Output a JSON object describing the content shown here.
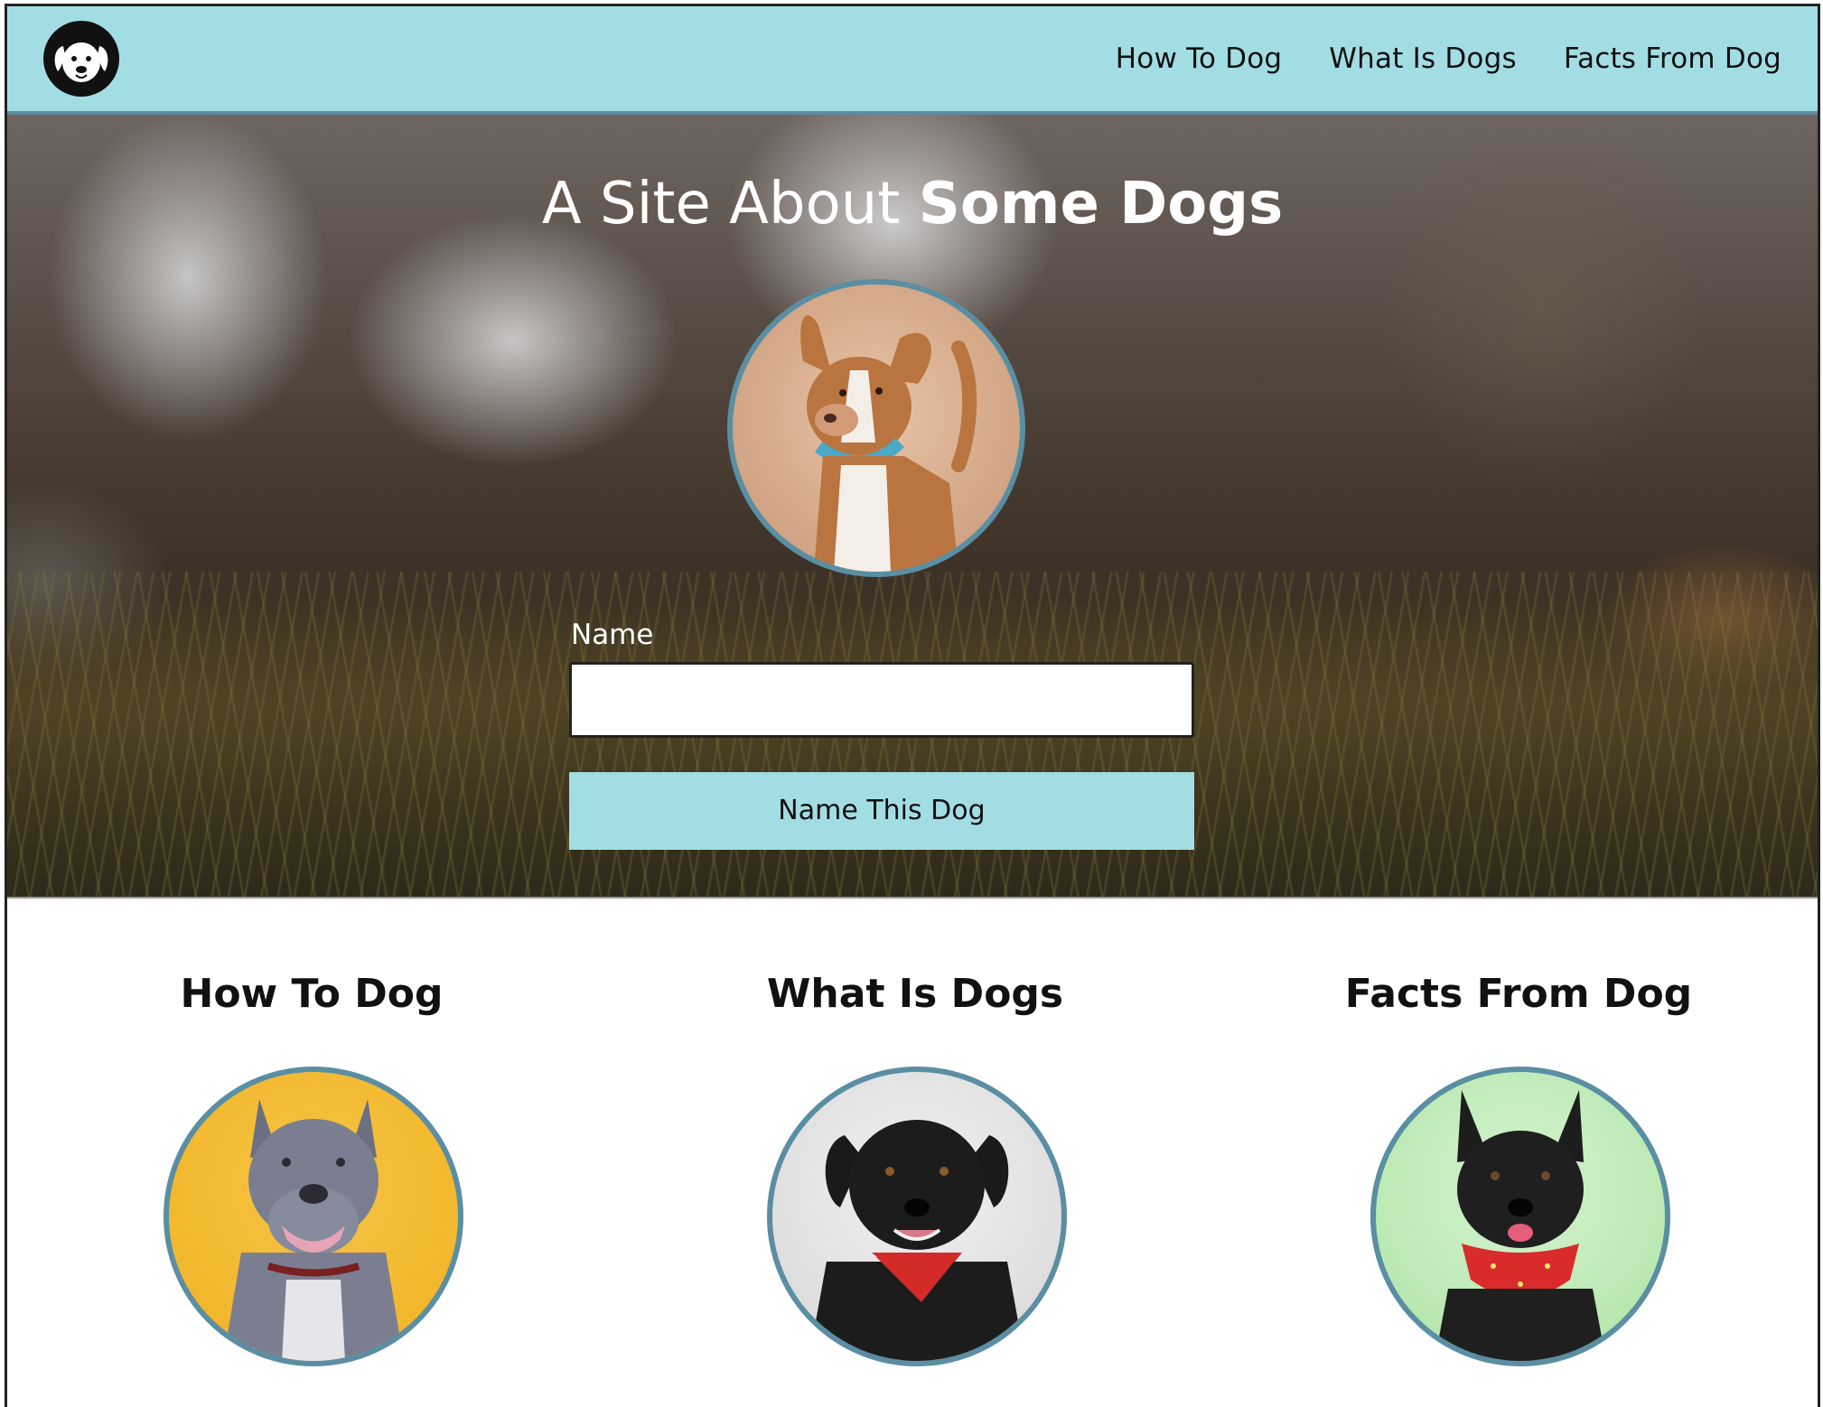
{
  "header": {
    "logo_icon": "dog-face-icon",
    "nav": [
      {
        "label": "How To Dog"
      },
      {
        "label": "What Is Dogs"
      },
      {
        "label": "Facts From Dog"
      }
    ]
  },
  "hero": {
    "title_light": "A Site About ",
    "title_bold": "Some Dogs",
    "photo": "tan-and-white-dog-with-blue-bandana",
    "form": {
      "name_label": "Name",
      "name_value": "",
      "submit_label": "Name This Dog"
    }
  },
  "cards": [
    {
      "title": "How To Dog",
      "photo": "gray-pitbull-on-yellow"
    },
    {
      "title": "What Is Dogs",
      "photo": "black-dog-with-red-bandana-on-gray"
    },
    {
      "title": "Facts From Dog",
      "photo": "black-dog-with-red-bandana-on-green"
    }
  ],
  "colors": {
    "accent": "#a3dde4",
    "ring": "#5a8ea3",
    "text": "#111111"
  }
}
